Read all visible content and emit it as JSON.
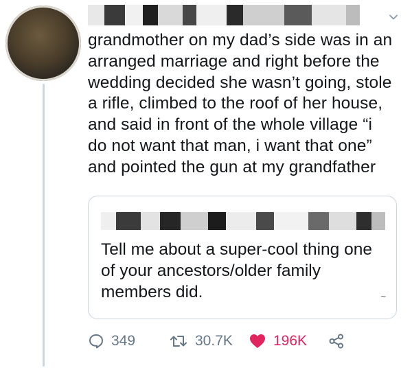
{
  "tweet": {
    "author_name_censored": "",
    "text_lines": [
      "grandmother on my dad’s side was in an",
      "arranged marriage and right before the",
      "wedding decided she wasn’t going, stole",
      "a rifle, climbed to the roof of her house,",
      "and said in front of the whole village “i",
      "do not want that man, i want that one”",
      "and pointed the gun at my grandfather"
    ]
  },
  "quoted_tweet": {
    "author_name_censored": "",
    "text_lines": [
      "Tell me about a super-cool thing one",
      "of your ancestors/older family",
      "members did."
    ]
  },
  "actions": {
    "replies": "349",
    "retweets": "30.7K",
    "likes": "196K"
  },
  "icons": {
    "avatar": "profile-avatar",
    "menu": "chevron-down-icon",
    "reply": "reply-icon",
    "retweet": "retweet-icon",
    "like": "heart-icon",
    "share": "share-icon"
  },
  "colors": {
    "like": "#e0245e",
    "muted": "#657786",
    "border": "#ccd6dd"
  }
}
